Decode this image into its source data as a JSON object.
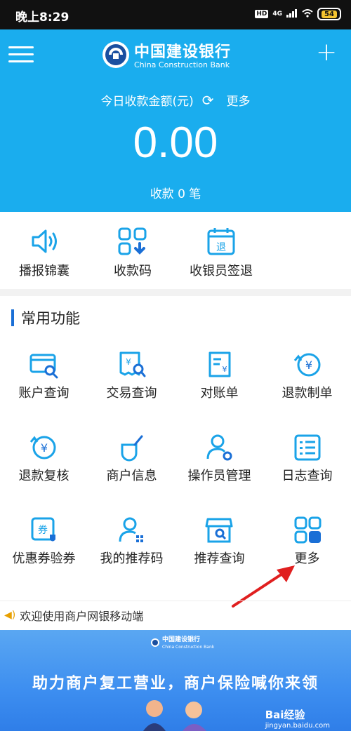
{
  "status_bar": {
    "time": "晚上8:29",
    "hd": "HD",
    "net": "4G",
    "battery": "54"
  },
  "header": {
    "bank_cn": "中国建设银行",
    "bank_en": "China Construction Bank",
    "amount_label": "今日收款金额(元)",
    "more_label": "更多",
    "amount": "0.00",
    "count": "收款 0 笔",
    "accent_color": "#1aadee"
  },
  "quick_actions": [
    {
      "label": "播报锦囊",
      "icon": "speaker-icon"
    },
    {
      "label": "收款码",
      "icon": "qr-code-icon"
    },
    {
      "label": "收银员签退",
      "icon": "calendar-checkout-icon"
    }
  ],
  "common_functions": {
    "title": "常用功能",
    "items": [
      {
        "label": "账户查询",
        "icon": "card-search-icon"
      },
      {
        "label": "交易查询",
        "icon": "receipt-search-icon"
      },
      {
        "label": "对账单",
        "icon": "statement-icon"
      },
      {
        "label": "退款制单",
        "icon": "refund-create-icon"
      },
      {
        "label": "退款复核",
        "icon": "refund-review-icon"
      },
      {
        "label": "商户信息",
        "icon": "merchant-info-icon"
      },
      {
        "label": "操作员管理",
        "icon": "operator-settings-icon"
      },
      {
        "label": "日志查询",
        "icon": "log-list-icon"
      },
      {
        "label": "优惠券验券",
        "icon": "coupon-verify-icon"
      },
      {
        "label": "我的推荐码",
        "icon": "user-code-icon"
      },
      {
        "label": "推荐查询",
        "icon": "store-search-icon"
      },
      {
        "label": "更多",
        "icon": "more-grid-icon"
      }
    ]
  },
  "notice": "欢迎使用商户网银移动端",
  "banner": {
    "logo_text": "中国建设银行",
    "logo_en": "China Construction Bank",
    "headline": "助力商户复工营业，商户保险喊你来领",
    "watermark": "Bai经验",
    "watermark_url": "jingyan.baidu.com"
  }
}
